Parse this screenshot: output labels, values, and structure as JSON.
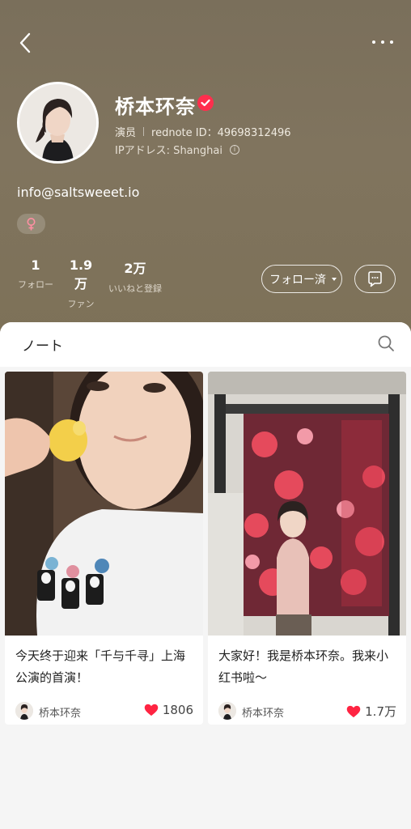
{
  "profile": {
    "name": "桥本环奈",
    "role": "演员",
    "rednote_id": "rednote ID：49698312496",
    "ip": "IPアドレス: Shanghai",
    "email": "info@saltsweeet.io",
    "gender_symbol": "♀"
  },
  "stats": [
    {
      "value": "1",
      "label": "フォロー"
    },
    {
      "value": "1.9万",
      "label": "ファン"
    },
    {
      "value": "2万",
      "label": "いいねと登録"
    }
  ],
  "actions": {
    "follow_label": "フォロー済"
  },
  "tabs": {
    "notes_label": "ノート"
  },
  "notes": [
    {
      "title": "今天终于迎来「千与千寻」上海公演的首演！",
      "author": "桥本环奈",
      "likes": "1806"
    },
    {
      "title": "大家好！我是桥本环奈。我来小红书啦～",
      "author": "桥本环奈",
      "likes": "1.7万"
    }
  ],
  "colors": {
    "header_bg": "#7d7158",
    "accent": "#ff2e4d",
    "heart": "#ff2442"
  }
}
